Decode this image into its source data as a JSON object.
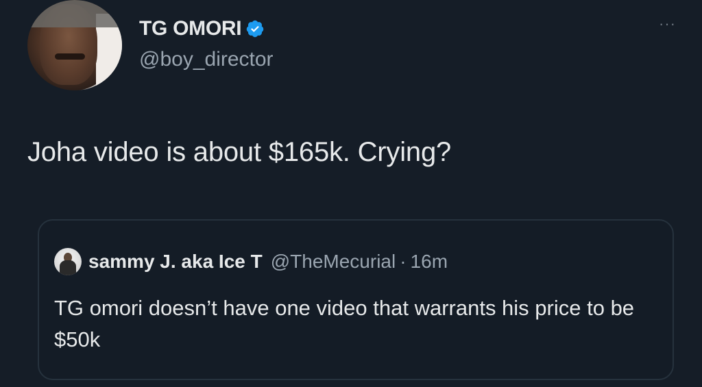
{
  "tweet": {
    "display_name": "TG OMORI",
    "handle": "@boy_director",
    "verified": true,
    "more_label": "···",
    "text": "Joha video is about $165k. Crying?"
  },
  "quoted_tweet": {
    "display_name": "sammy J. aka Ice T",
    "handle": "@TheMecurial",
    "separator": "·",
    "time": "16m",
    "text": "TG omori doesn’t have one video that warrants his price to be $50k"
  },
  "icons": {
    "verified": "verified-badge-icon",
    "more": "more-options-icon"
  },
  "colors": {
    "background": "#151d27",
    "text": "#e7e9ea",
    "secondary_text": "#9aa5b0",
    "verified_blue": "#1d9bf0",
    "quote_border": "#26323d"
  }
}
